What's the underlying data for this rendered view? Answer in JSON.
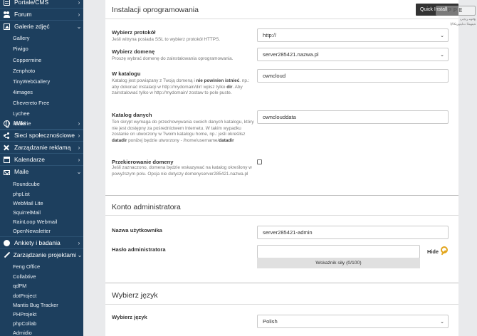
{
  "sidebar": {
    "categories": {
      "portale": "Portale/CMS",
      "forum": "Forum",
      "galerie": "Galerie zdjęć",
      "wiki": "Wiki",
      "sieci": "Sieci społecznościowe",
      "reklama": "Zarządzanie reklamą",
      "kalendarze": "Kalendarze",
      "maile": "Maile",
      "ankiety": "Ankiety i badania",
      "projekty": "Zarządzanie projektami"
    },
    "galerie_items": [
      "Gallery",
      "Piwigo",
      "Coppermine",
      "Zenphoto",
      "TinyWebGallery",
      "4images",
      "Chevereto Free",
      "Lychee",
      "iGalerie"
    ],
    "maile_items": [
      "Roundcube",
      "phpList",
      "WebMail Lite",
      "SquirrelMail",
      "RainLoop Webmail",
      "OpenNewsletter"
    ],
    "projekty_items": [
      "Feng Office",
      "Collabtive",
      "qdPM",
      "dotProject",
      "Mantis Bug Tracker",
      "PHProjekt",
      "phpCollab",
      "Admidio"
    ]
  },
  "top_button": {
    "label": "Quick Install"
  },
  "watermark": {
    "logo": "PPE",
    "sub1": "ﻊﻗﻮﻣ ﻦﺠﻳﺮﺑ",
    "sub2": "ﺔﻴﻨﻬﻤﻟﺍ ﺕﺎﻴﻧﻭﺮﺘﻜﻟﻹﺍ"
  },
  "install_section": {
    "title": "Instalacji oprogramowania",
    "protocol": {
      "label": "Wybierz protokół",
      "help": "Jeśli witryna posiada SSL to wybierz protokół HTTPS.",
      "value": "http://"
    },
    "domain": {
      "label": "Wybierz domenę",
      "help": "Proszę wybrać domenę do zainstalowania oprogramowania.",
      "value": "server285421.nazwa.pl"
    },
    "directory": {
      "label": "W katalogu",
      "help_1": "Katalog jest powiązany z Twoją domeną i ",
      "help_bold_1": "nie powinien istnieć",
      "help_2": ". np.: aby dokonać instalacji w http://mydomain/dir/ wpisz tylko ",
      "help_bold_2": "dir",
      "help_3": ". Aby zainstalować tylko w http://mydomain/ zostaw to pole puste.",
      "value": "owncloud"
    },
    "data_dir": {
      "label": "Katalog danych",
      "help_1": "Ten skrypt wymaga do przechowywania swoich danych katalogu, który nie jest dostępny za pośrednictwem Internetu. W takim wypadku zostanie on utworzony w Twoim katalogu home, np.: jeśli określisz ",
      "help_bold": "datadir",
      "help_2": " poniżej będzie utworzony - /home/username/",
      "help_bold_2": "datadir",
      "value": "ownclouddata"
    },
    "redirect": {
      "label": "Przekierowanie domeny",
      "help": "Jeśli zaznaczono, domena będzie wskazywać na katalog określony w powyższym polu. Opcja nie dotyczy domenyserver285421.nazwa.pl",
      "checked": false
    }
  },
  "admin_section": {
    "title": "Konto administratora",
    "username": {
      "label": "Nazwa użytkownika",
      "value": "server285421-admin"
    },
    "password": {
      "label": "Hasło administratora",
      "value": "",
      "strength_label": "Wskaźnik siły (0/100)",
      "hide_label": "Hide"
    }
  },
  "language_section": {
    "title": "Wybierz język",
    "language": {
      "label": "Wybierz język",
      "value": "Polish"
    }
  }
}
